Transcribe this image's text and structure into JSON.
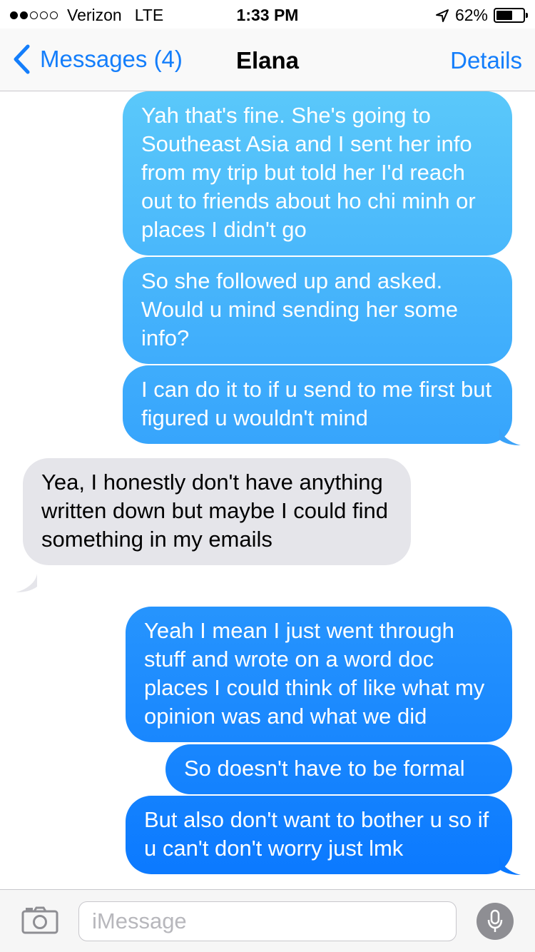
{
  "status_bar": {
    "carrier": "Verizon",
    "network": "LTE",
    "time": "1:33 PM",
    "battery_percent": "62%",
    "battery_level": 0.62,
    "signal_bars_filled": 2,
    "signal_bars_total": 5
  },
  "nav": {
    "back_label": "Messages (4)",
    "title": "Elana",
    "details_label": "Details"
  },
  "messages": [
    {
      "direction": "outgoing",
      "text": "Yah that's fine. She's going to Southeast Asia and I sent her info from my trip but told her I'd reach out to friends about ho chi minh or places I didn't go"
    },
    {
      "direction": "outgoing",
      "text": "So she followed up and asked. Would u mind sending her some info?"
    },
    {
      "direction": "outgoing",
      "text": "I can do it to if u send to me first but figured u wouldn't mind"
    },
    {
      "direction": "incoming",
      "text": "Yea, I honestly don't have anything written down but maybe I could find something in my emails"
    },
    {
      "direction": "outgoing",
      "text": "Yeah I mean I just went through stuff and wrote on a word doc places I could think of like what my opinion was and what we did"
    },
    {
      "direction": "outgoing",
      "text": "So doesn't have to be formal"
    },
    {
      "direction": "outgoing",
      "text": "But also don't want to bother u so if u can't don't worry just lmk"
    }
  ],
  "input": {
    "placeholder": "iMessage",
    "value": ""
  },
  "colors": {
    "accent": "#147efb",
    "incoming_bubble": "#e5e5ea",
    "bubble_gradient_top": "#5ac8fa",
    "bubble_gradient_bottom": "#0a78ff"
  },
  "icons": {
    "back": "chevron-left-icon",
    "camera": "camera-icon",
    "mic": "microphone-icon",
    "location": "location-arrow-icon",
    "battery": "battery-icon"
  }
}
